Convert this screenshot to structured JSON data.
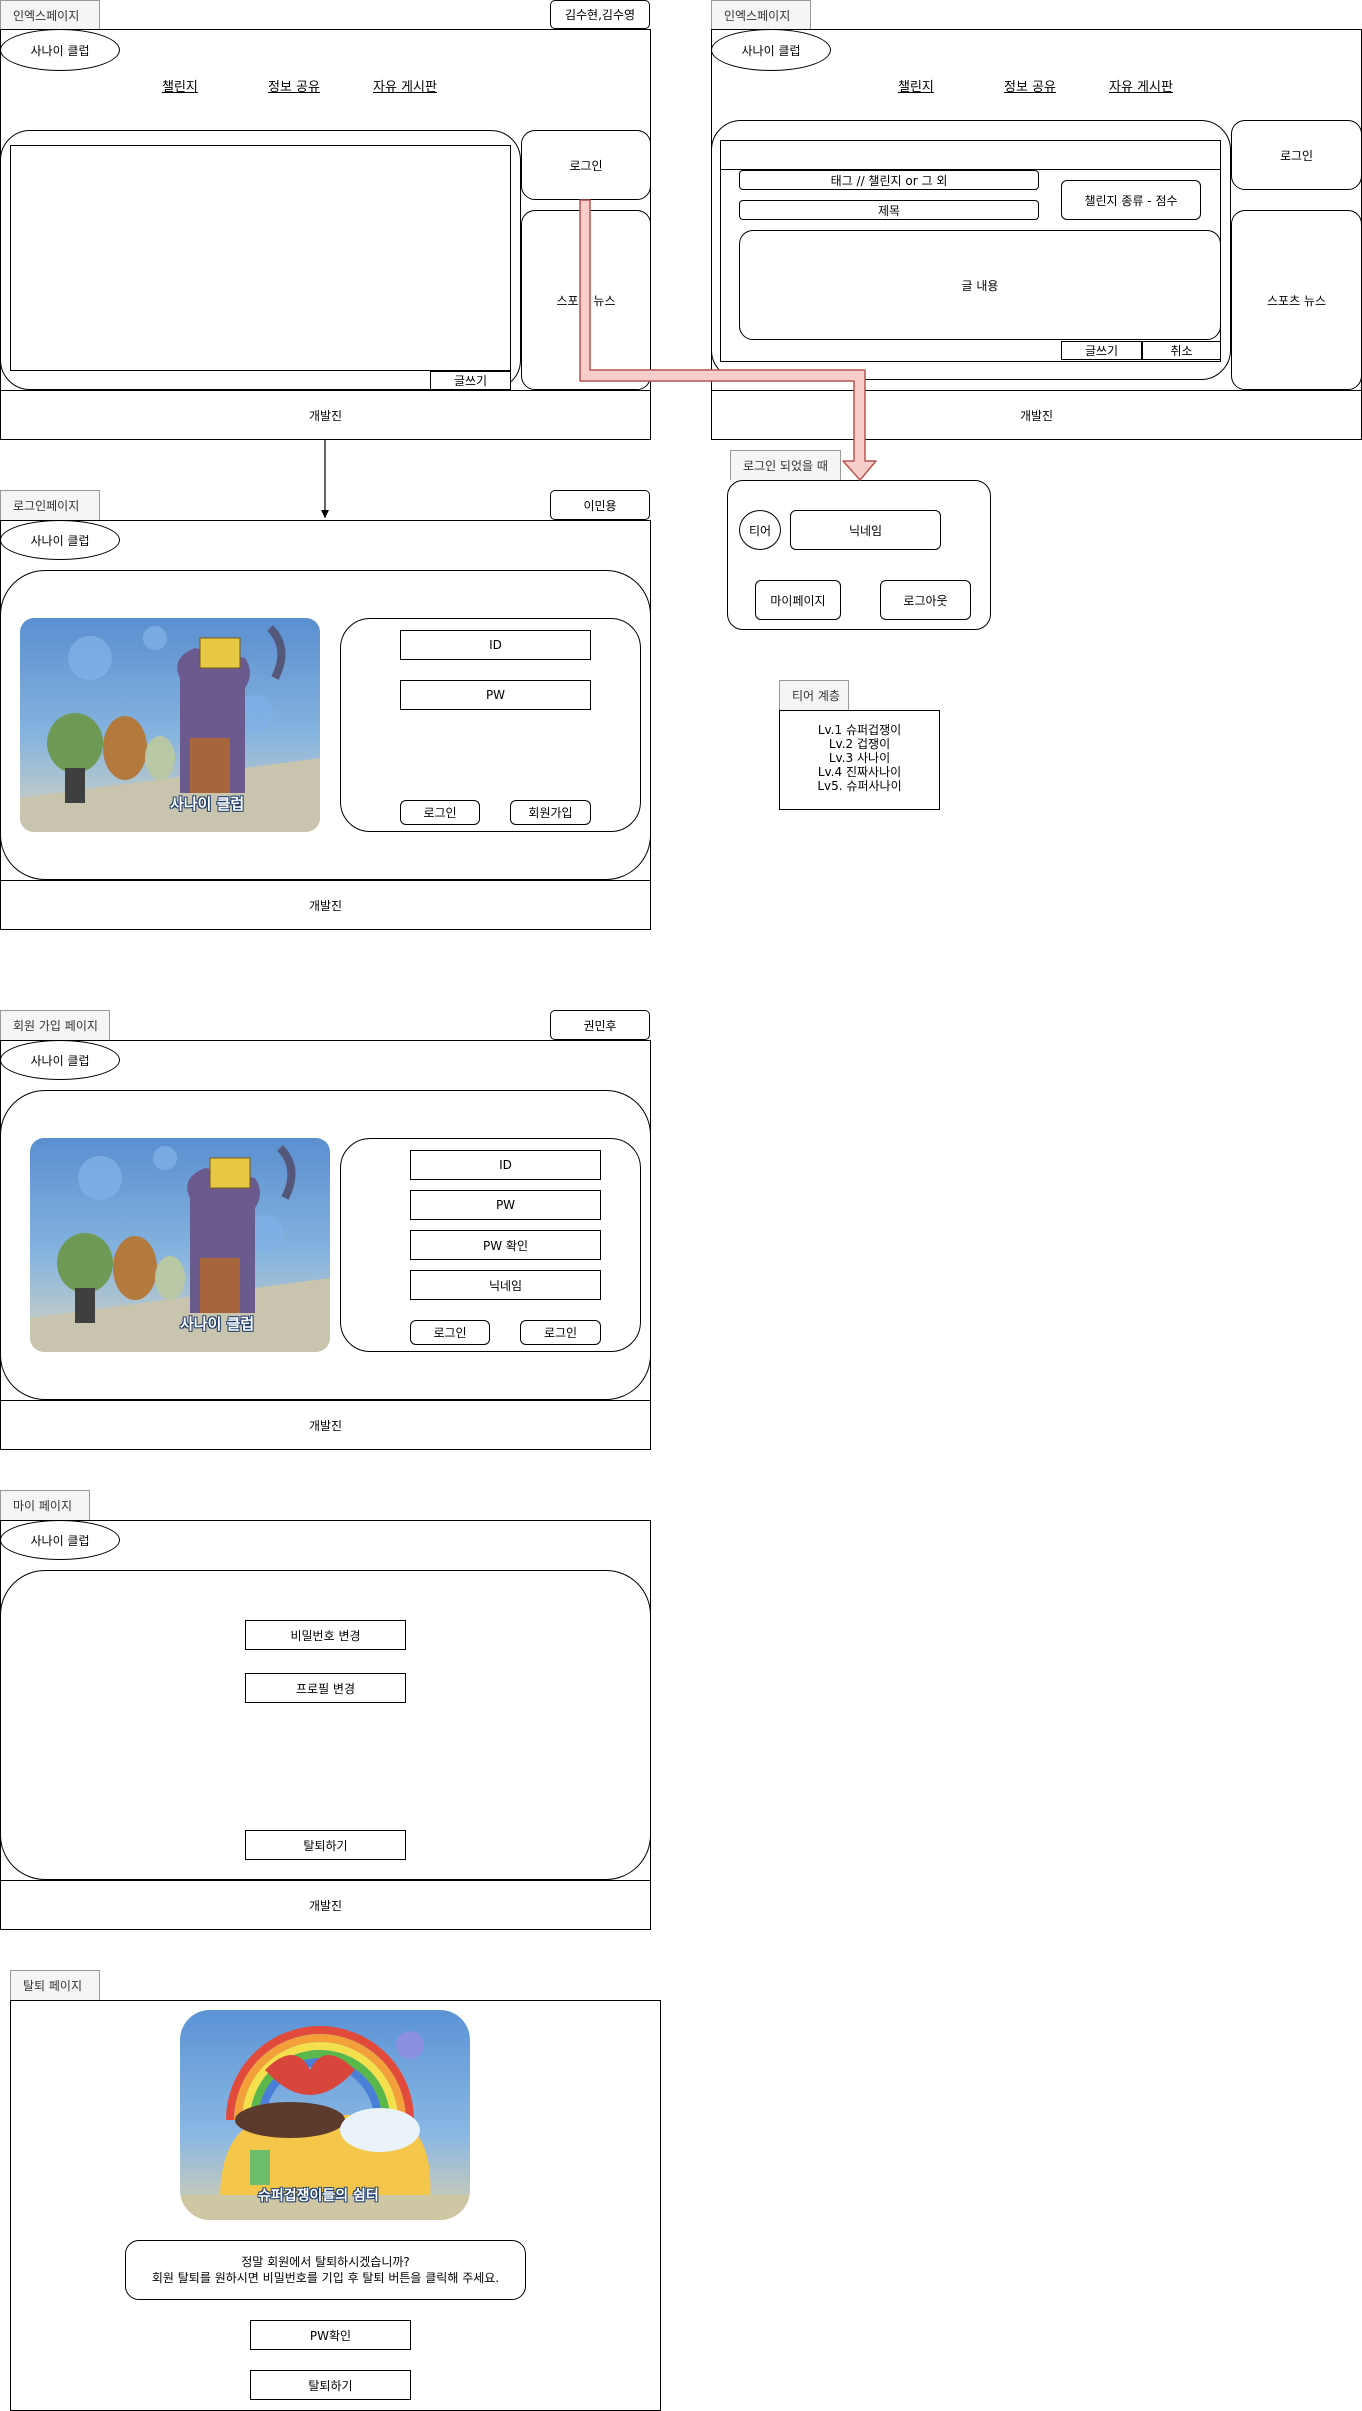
{
  "colors": {
    "arrow_fill": "#f8cecc",
    "arrow_stroke": "#b85450",
    "tab_fill": "#f5f5f5",
    "tab_text": "#333333"
  },
  "common": {
    "logo": "사나이 클럽",
    "nav": [
      "챌린지",
      "정보 공유",
      "자유 게시판"
    ],
    "footer": "개발진",
    "login_button": "로그인",
    "sports_news": "스포츠 뉴스"
  },
  "index_page_1": {
    "tab": "인엑스페이지",
    "author": "김수현,김수영",
    "write_button": "글쓰기",
    "sports_news": "스포ㅊ 뉴스"
  },
  "index_page_2": {
    "tab": "인엑스페이지",
    "tag_field": "태그 // 챌린지 or 그 외",
    "title_field": "제목",
    "challenge_type": "챌린지 종류 - 점수",
    "content_field": "글 내용",
    "write_button": "글쓰기",
    "cancel_button": "취소"
  },
  "logged_in": {
    "label": "로그인 되었을 때",
    "tier": "티어",
    "nickname": "닉네임",
    "mypage": "마이페이지",
    "logout": "로그아웃"
  },
  "tier_levels": {
    "label": "티어 계층",
    "items": [
      "Lv.1 슈퍼겁쟁이",
      "Lv.2 겁쟁이",
      "Lv.3 사나이",
      "Lv.4 진짜사나이",
      "Lv5. 슈퍼사나이"
    ]
  },
  "login_page": {
    "tab": "로그인페이지",
    "author": "이민용",
    "id": "ID",
    "pw": "PW",
    "login": "로그인",
    "signup": "회원가입",
    "image_caption": "사나이 클럽"
  },
  "signup_page": {
    "tab": "회원 가입 페이지",
    "author": "권민후",
    "id": "ID",
    "pw": "PW",
    "pw_confirm": "PW 확인",
    "nickname": "닉네임",
    "button_1": "로그인",
    "button_2": "로그인",
    "image_caption": "사나이 클럽"
  },
  "my_page": {
    "tab": "마이 페이지",
    "change_password": "비밀번호 변경",
    "change_profile": "프로필 변경",
    "withdraw": "탈퇴하기"
  },
  "withdraw_page": {
    "tab": "탈퇴 페이지",
    "image_caption": "슈퍼겁쟁이들의 쉼터",
    "message_line1": "정말 회원에서 탈퇴하시겠습니까?",
    "message_line2": "회원 탈퇴를 원하시면 비밀번호를 기입 후 탈퇴 버튼을 클릭해 주세요.",
    "pw_confirm": "PW확인",
    "withdraw": "탈퇴하기"
  }
}
